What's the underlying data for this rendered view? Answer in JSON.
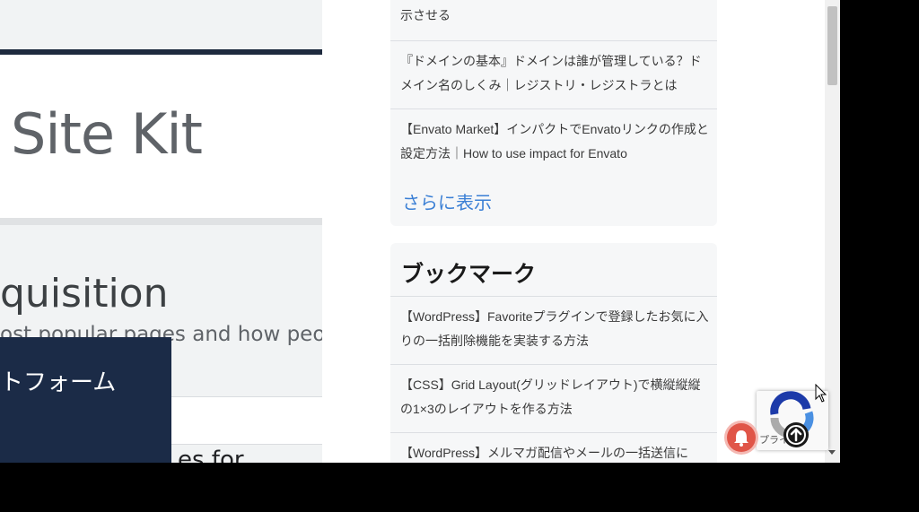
{
  "main_image": {
    "heading": "Site Kit",
    "section_title": "quisition",
    "section_subtitle": "ost popular pages and how peop",
    "overlay_text": "トフォーム",
    "table_header": "es for"
  },
  "sidebar_recent": {
    "items": [
      {
        "text": "示させる"
      },
      {
        "text": "『ドメインの基本』ドメインは誰が管理している？ドメイン名のしくみ｜レジストリ・レジストラとは"
      },
      {
        "text": "【Envato Market】インパクトでEnvatoリンクの作成と設定方法｜How to use impact for Envato"
      }
    ],
    "more_label": "さらに表示"
  },
  "bookmarks": {
    "title": "ブックマーク",
    "items": [
      {
        "text": "【WordPress】Favoriteプラグインで登録したお気に入りの一括削除機能を実装する方法"
      },
      {
        "text": "【CSS】Grid Layout(グリッドレイアウト)で横縦縦縦の1×3のレイアウトを作る方法"
      },
      {
        "text": "【WordPress】メルマガ配信やメールの一括送信に"
      }
    ]
  },
  "recaptcha": {
    "label": "プライ"
  },
  "icons": {
    "recaptcha": "recaptcha-logo-icon",
    "bell": "notification-bell-icon",
    "scroll_top": "arrow-up-icon",
    "cursor": "mouse-pointer-icon"
  },
  "colors": {
    "link": "#3a7fd5",
    "overlay_dark": "#1b2b47",
    "bell": "#e05548",
    "card_bg": "#f6f7f8"
  }
}
